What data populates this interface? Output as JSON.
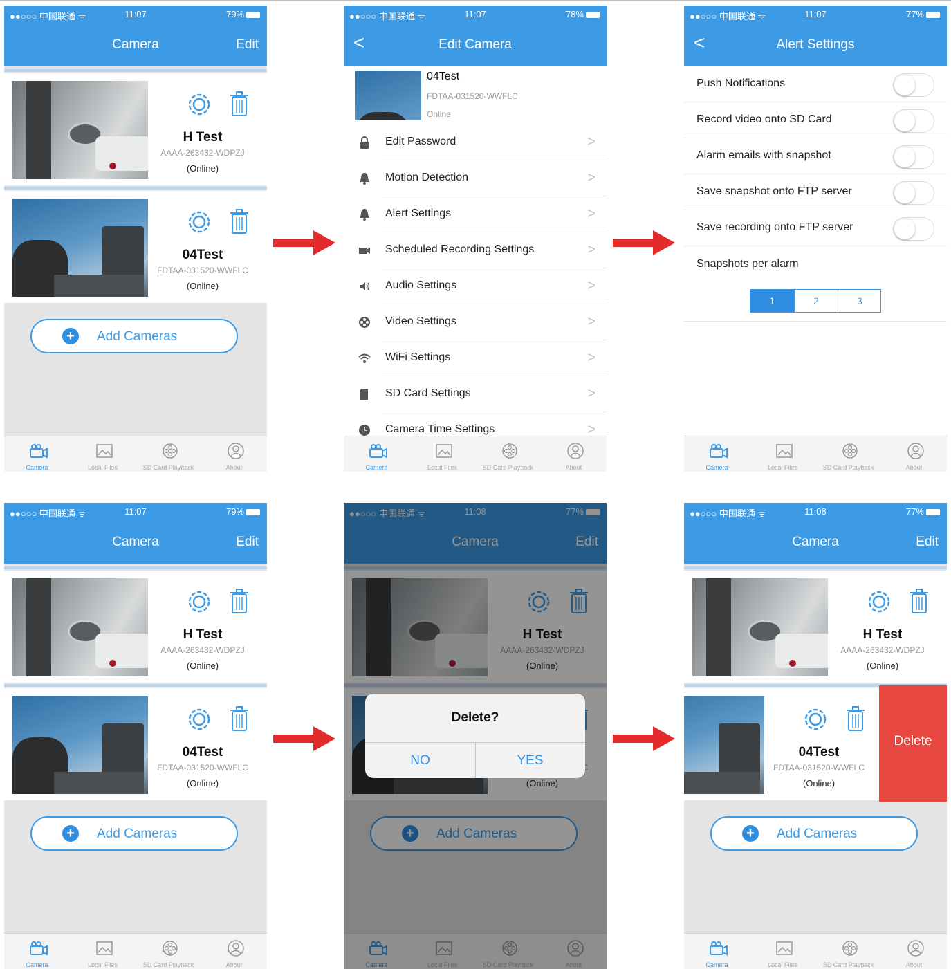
{
  "status": {
    "carrier": "●●○○○ 中国联通 ᯤ",
    "screens": [
      {
        "time": "11:07",
        "battery": "79%"
      },
      {
        "time": "11:07",
        "battery": "78%"
      },
      {
        "time": "11:07",
        "battery": "77%"
      },
      {
        "time": "11:07",
        "battery": "79%"
      },
      {
        "time": "11:08",
        "battery": "77%"
      },
      {
        "time": "11:08",
        "battery": "77%"
      }
    ]
  },
  "camera_list": {
    "title": "Camera",
    "edit": "Edit",
    "cameras": [
      {
        "name": "H Test",
        "id": "AAAA-263432-WDPZJ",
        "status": "(Online)"
      },
      {
        "name": "04Test",
        "id": "FDTAA-031520-WWFLC",
        "status": "(Online)"
      }
    ],
    "add_cameras": "Add Cameras",
    "plus": "+"
  },
  "edit_camera": {
    "back": "<",
    "title": "Edit Camera",
    "camera": {
      "name": "04Test",
      "id": "FDTAA-031520-WWFLC",
      "status": "Online"
    },
    "chevron": ">",
    "items": [
      {
        "label": "Edit Password",
        "icon": "lock-icon"
      },
      {
        "label": "Motion Detection",
        "icon": "bell-icon"
      },
      {
        "label": "Alert Settings",
        "icon": "bell-icon"
      },
      {
        "label": "Scheduled Recording Settings",
        "icon": "video-icon"
      },
      {
        "label": "Audio Settings",
        "icon": "speaker-icon"
      },
      {
        "label": "Video Settings",
        "icon": "reel-icon"
      },
      {
        "label": "WiFi Settings",
        "icon": "wifi-icon"
      },
      {
        "label": "SD Card Settings",
        "icon": "sdcard-icon"
      },
      {
        "label": "Camera Time Settings",
        "icon": "clock-icon"
      }
    ]
  },
  "alert_settings": {
    "back": "<",
    "title": "Alert Settings",
    "toggles": [
      {
        "label": "Push Notifications",
        "on": false
      },
      {
        "label": "Record video onto SD Card",
        "on": false
      },
      {
        "label": "Alarm emails with snapshot",
        "on": false
      },
      {
        "label": "Save snapshot onto FTP server",
        "on": false
      },
      {
        "label": "Save recording onto FTP server",
        "on": false
      }
    ],
    "snapshots_label": "Snapshots per alarm",
    "snapshot_options": [
      "1",
      "2",
      "3"
    ],
    "snapshot_selected": "1"
  },
  "delete_dialog": {
    "title": "Delete?",
    "no": "NO",
    "yes": "YES"
  },
  "swipe_delete": "Delete",
  "tabbar": {
    "tabs": [
      {
        "label": "Camera",
        "icon": "camera-icon"
      },
      {
        "label": "Local Files",
        "icon": "image-icon"
      },
      {
        "label": "SD Card Playback",
        "icon": "film-reel-icon"
      },
      {
        "label": "About",
        "icon": "person-icon"
      }
    ]
  },
  "colors": {
    "accent": "#3d9be6",
    "arrow": "#e32b2b",
    "delete": "#e8473f"
  }
}
